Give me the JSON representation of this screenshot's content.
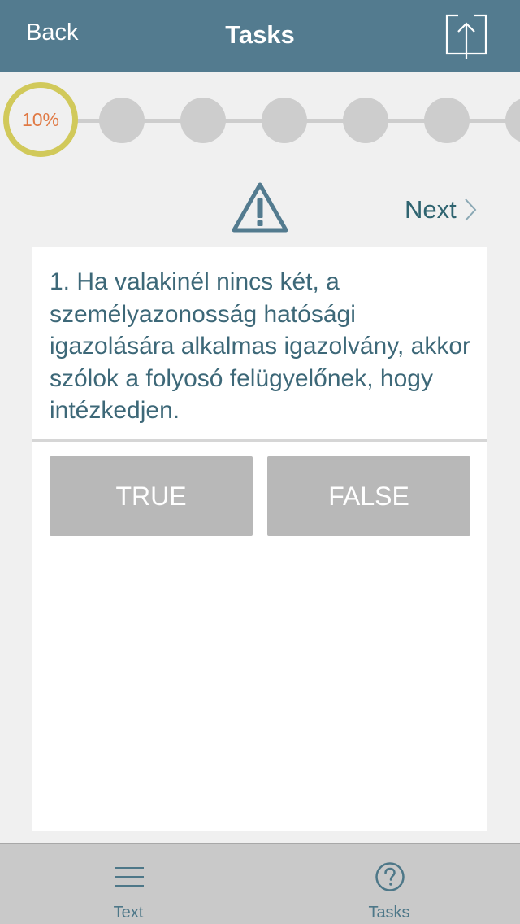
{
  "nav": {
    "back_label": "Back",
    "title": "Tasks",
    "share_icon": "share-icon"
  },
  "progress": {
    "current_label": "10%",
    "current_fraction": 0.1
  },
  "task": {
    "next_label": "Next",
    "warning_icon": "warning-triangle-icon",
    "question": "1. Ha valakinél nincs két, a személyazonosság hatósági igazolására alkalmas igazolvány, akkor szólok a folyosó felügyelőnek, hogy intézkedjen.",
    "true_label": "TRUE",
    "false_label": "FALSE"
  },
  "tabbar": {
    "text_label": "Text",
    "tasks_label": "Tasks"
  },
  "colors": {
    "navbar": "#537b8f",
    "accent_text": "#3d6878",
    "progress_ring": "#d1c95a",
    "progress_text": "#e07a45",
    "button_gray": "#b8b8b8"
  }
}
